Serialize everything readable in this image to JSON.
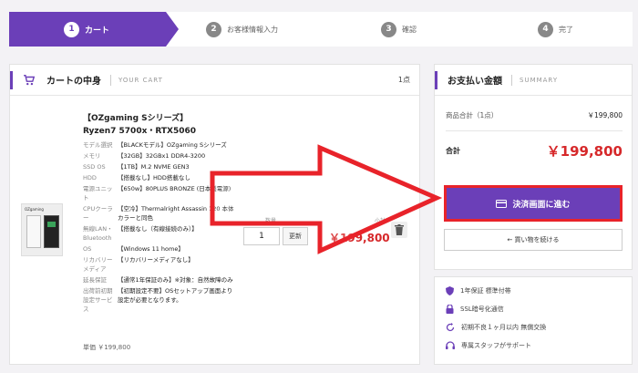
{
  "steps": [
    {
      "num": "1",
      "label": "カート"
    },
    {
      "num": "2",
      "label": "お客様情報入力"
    },
    {
      "num": "3",
      "label": "確認"
    },
    {
      "num": "4",
      "label": "完了"
    }
  ],
  "cart": {
    "title": "カートの中身",
    "subtitle": "YOUR CART",
    "count": "1点",
    "thumb_logo": "OZgaming",
    "product_name_line1": "【OZgaming Sシリーズ】",
    "product_name_line2": "Ryzen7 5700x・RTX5060",
    "specs": [
      {
        "label": "モデル選択",
        "value": "【BLACKモデル】OZgaming Sシリーズ"
      },
      {
        "label": "メモリ",
        "value": "【32GB】32GBx1 DDR4-3200"
      },
      {
        "label": "SSD OS",
        "value": "【1TB】M.2 NVME GEN3"
      },
      {
        "label": "HDD",
        "value": "【搭載なし】HDD搭載なし"
      },
      {
        "label": "電源ユニット",
        "value": "【650w】80PLUS BRONZE (日本製電源)"
      },
      {
        "label": "CPUクーラー",
        "value": "【空冷】Thermalright Assassin 120 本体カラーと同色"
      },
      {
        "label": "無線LAN・Bluetooth",
        "value": "【搭載なし（有線接続のみ）】"
      },
      {
        "label": "OS",
        "value": "【Windows 11 home】"
      },
      {
        "label": "リカバリーメディア",
        "value": "【リカバリーメディアなし】"
      },
      {
        "label": "延長保証",
        "value": "【通常1年保証のみ】※対象：自然故障のみ"
      },
      {
        "label": "出荷前初期設定サービス",
        "value": "【初期設定不要】OSセットアップ画面より設定が必要となります。"
      }
    ],
    "unit_price": "単価 ￥199,800",
    "qty_caption": "数量",
    "qty_value": "1",
    "update_label": "更新",
    "subtotal_caption": "小計",
    "line_total": "￥199,800"
  },
  "summary": {
    "title": "お支払い金額",
    "subtitle": "SUMMARY",
    "subtotal_label": "商品合計（1点）",
    "subtotal_value": "￥199,800",
    "total_label": "合計",
    "total_value": "￥199,800",
    "checkout_label": "決済画面に進む",
    "continue_label": "← 買い物を続ける"
  },
  "guarantees": [
    {
      "icon": "shield-icon",
      "text": "1年保証 標準付帯"
    },
    {
      "icon": "lock-icon",
      "text": "SSL暗号化通信"
    },
    {
      "icon": "refresh-icon",
      "text": "初期不良１ヶ月以内 無償交換"
    },
    {
      "icon": "headset-icon",
      "text": "専属スタッフがサポート"
    }
  ],
  "colors": {
    "accent": "#6b3fb8",
    "price": "#d6282a",
    "highlight": "#e8232a"
  }
}
